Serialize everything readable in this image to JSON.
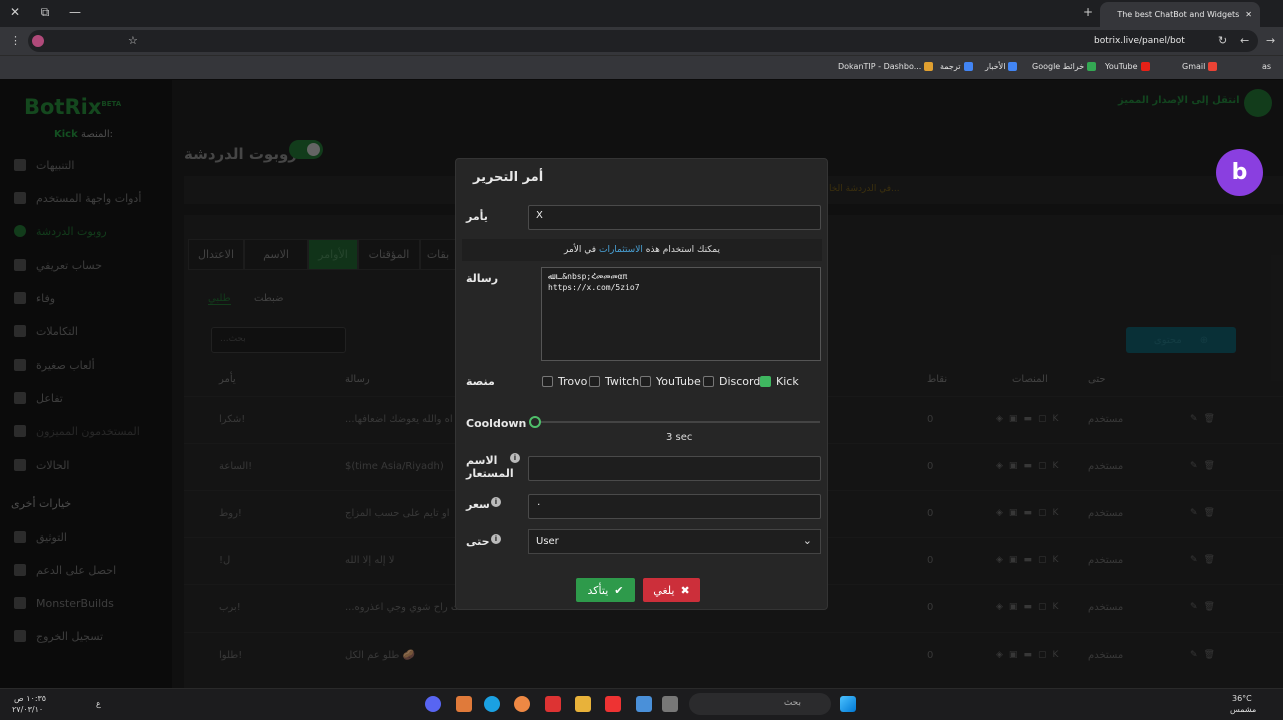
{
  "browser": {
    "tab_title": "The best ChatBot and Widgets",
    "url": "botrix.live/panel/bot",
    "bookmarks": [
      "as",
      "Gmail",
      "YouTube",
      "Google خرائط",
      "الأخبار",
      "ترجمة",
      "DokanTIP - Dashbo..."
    ]
  },
  "sidebar": {
    "logo": "BotRix",
    "logo_badge": "BETA",
    "platform_label": "المنصة:",
    "platform_value": "Kick",
    "items": [
      "التنبيهات",
      "أدوات واجهة المستخدم",
      "روبوت الدردشة",
      "حساب تعريفي",
      "وفاء",
      "التكاملات",
      "ألعاب صغيرة",
      "تفاعل",
      "المستخدمون المميزون",
      "الحالات"
    ],
    "other_title": "خيارات أخرى",
    "other_items": [
      "التوثيق",
      "احصل على الدعم",
      "MonsterBuilds",
      "تسجيل الخروج"
    ]
  },
  "header": {
    "title": "روبوت الدردشة",
    "upgrade": "انتقل إلى الإصدار المميز",
    "notice": "في الدردشة الخا..."
  },
  "tabs": [
    "الاعتدال",
    "الاسم",
    "الأوامر",
    "المؤقتات",
    "بقات"
  ],
  "subtabs": {
    "active": "طلبي",
    "other": "ضبطت"
  },
  "search_placeholder": "...بحث",
  "add_button": "محتوى",
  "table": {
    "headers": {
      "command": "يأمر",
      "message": "رسالة",
      "points": "نقاط",
      "platforms": "المنصات",
      "until": "حتى"
    },
    "rows": [
      {
        "command": "شكرا!",
        "message": "...اه والله يعوضك اضعافها",
        "points": "0",
        "until": "مستخدم"
      },
      {
        "command": "الساعة!",
        "message": "$(time Asia/Riyadh)",
        "points": "0",
        "until": "مستخدم"
      },
      {
        "command": "روط!",
        "message": "او تايم على حسب المزاج",
        "points": "0",
        "until": "مستخدم"
      },
      {
        "command": "!ل",
        "message": "لا إله إلا الله",
        "points": "0",
        "until": "مستخدم"
      },
      {
        "command": "برب!",
        "message": "...ت راح شوي وجي اعذروه",
        "points": "0",
        "until": "مستخدم"
      },
      {
        "command": "طلوا!",
        "message": "طلو عم الكل 🥔",
        "points": "0",
        "until": "مستخدم"
      }
    ]
  },
  "modal": {
    "title": "أمر التحرير",
    "command_label": "يأمر",
    "command_value": "X",
    "hint_prefix": "يمكنك استخدام هذه",
    "hint_link": "الاستثمارات",
    "hint_suffix": "في الأمر",
    "message_label": "رسالة",
    "message_value": "ـ ﷲ&nbsp;Հመመመαπ\nhttps://x.com/5zio7",
    "platform_label": "منصة",
    "platforms": [
      {
        "name": "Trovo",
        "checked": false
      },
      {
        "name": "Twitch",
        "checked": false
      },
      {
        "name": "YouTube",
        "checked": false
      },
      {
        "name": "Discord",
        "checked": false
      },
      {
        "name": "Kick",
        "checked": true
      }
    ],
    "cooldown_label": "Cooldown",
    "cooldown_value": "3 sec",
    "cooldown_fraction": 0,
    "alias_label_1": "الاسم",
    "alias_label_2": "المستعار",
    "alias_value": "",
    "price_label": "سعر",
    "price_value": "٠",
    "until_label": "حتى",
    "until_value": "User",
    "confirm": "يتأكد",
    "cancel": "يلغي"
  },
  "taskbar": {
    "search": "بحث",
    "weather": "36°C",
    "weather_desc": "مشمس",
    "time": "١٠:٣٥ ص",
    "date": "٢٧/٠٣/١٠",
    "lang": "ع"
  },
  "colors": {
    "accent": "#2e9a4b",
    "danger": "#cc2f3a",
    "bot": "#8a3fe0"
  }
}
